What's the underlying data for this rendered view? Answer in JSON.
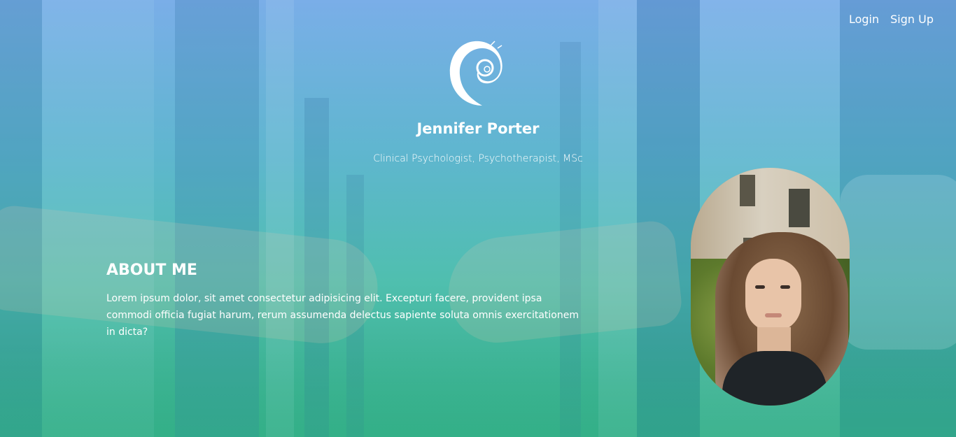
{
  "nav": {
    "login_label": "Login",
    "signup_label": "Sign Up"
  },
  "header": {
    "logo_icon": "swirl-logo-icon",
    "name": "Jennifer Porter",
    "subtitle": "Clinical Psychologist, Psychotherapist, MSc"
  },
  "about": {
    "heading": "ABOUT ME",
    "text": "Lorem ipsum dolor, sit amet consectetur adipisicing elit. Excepturi facere, provident ipsa commodi officia fugiat harum, rerum assumenda delectus sapiente soluta omnis exercitationem in dicta?"
  },
  "colors": {
    "gradient_top": "#7aaee8",
    "gradient_bottom": "#2fa880",
    "text": "#ffffff"
  }
}
